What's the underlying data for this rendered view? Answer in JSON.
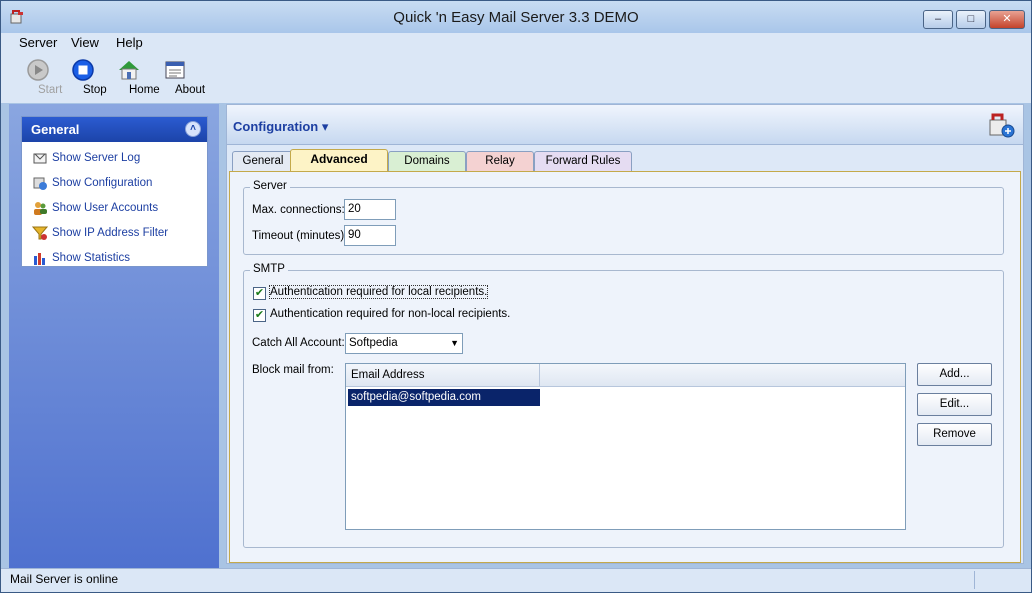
{
  "window": {
    "title": "Quick 'n Easy Mail Server 3.3 DEMO",
    "min_glyph": "–",
    "max_glyph": "□",
    "close_glyph": "✕"
  },
  "menu": {
    "items": [
      {
        "label": "Server",
        "accel": "S"
      },
      {
        "label": "View",
        "accel": "V"
      },
      {
        "label": "Help",
        "accel": "H"
      }
    ]
  },
  "toolbar": {
    "start_label": "Start",
    "stop_label": "Stop",
    "home_label": "Home",
    "about_label": "About"
  },
  "sidebar": {
    "group_title": "General",
    "collapse_glyph": "˄",
    "items": [
      {
        "label": "Show Server Log",
        "icon": "server-log-icon"
      },
      {
        "label": "Show Configuration",
        "icon": "configuration-icon"
      },
      {
        "label": "Show User Accounts",
        "icon": "user-accounts-icon"
      },
      {
        "label": "Show IP Address Filter",
        "icon": "filter-icon"
      },
      {
        "label": "Show Statistics",
        "icon": "statistics-icon"
      }
    ]
  },
  "main": {
    "title": "Configuration ▾",
    "tabs": [
      {
        "label": "General"
      },
      {
        "label": "Advanced"
      },
      {
        "label": "Domains"
      },
      {
        "label": "Relay"
      },
      {
        "label": "Forward Rules"
      }
    ],
    "active_tab": "Advanced",
    "server": {
      "legend": "Server",
      "max_connections_label": "Max. connections:",
      "max_connections_value": "20",
      "timeout_label": "Timeout (minutes):",
      "timeout_value": "90"
    },
    "smtp": {
      "legend": "SMTP",
      "auth_local_label": "Authentication required for local recipients.",
      "auth_local_checked": "✔",
      "auth_nonlocal_label": "Authentication required for non-local recipients.",
      "auth_nonlocal_checked": "✔",
      "catch_all_label": "Catch All Account:",
      "catch_all_value": "Softpedia",
      "dropdown_glyph": "▼",
      "block_label": "Block mail from:",
      "block_column": "Email Address",
      "block_rows": [
        "softpedia@softpedia.com"
      ],
      "add_label": "Add...",
      "edit_label": "Edit...",
      "remove_label": "Remove"
    }
  },
  "status": {
    "text": "Mail Server is online"
  },
  "colors": {
    "sidebar_head": "#2b5bd1",
    "link": "#1d3fa2",
    "selection": "#0a246a",
    "active_tab": "#fdf3c6"
  }
}
